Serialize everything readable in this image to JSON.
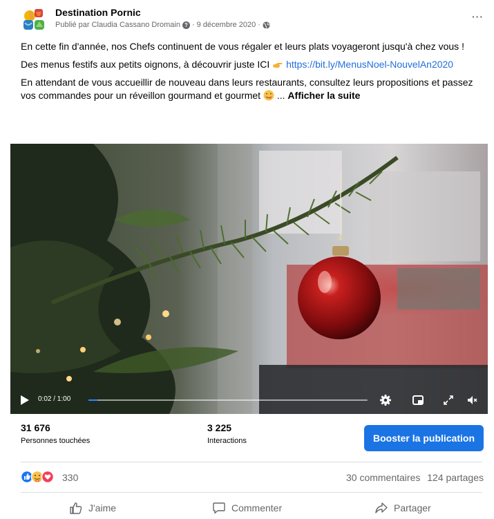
{
  "post": {
    "page_name": "Destination Pornic",
    "meta": {
      "published_by": "Publié par Claudia Cassano Dromain",
      "separator": "·",
      "date": "9 décembre 2020",
      "separator2": "·"
    },
    "more_label": "···",
    "text": {
      "p1": "En cette fin d'année, nos Chefs continuent de vous régaler et leurs plats voyageront jusqu'à chez vous !",
      "p2_before": "Des menus festifs aux petits oignons, à découvrir juste ICI",
      "p2_link": "https://bit.ly/MenusNoel-NouvelAn2020",
      "p3_before": "En attendant de vous accueillir de nouveau dans leurs restaurants, consultez leurs propositions et passez vos commandes pour un réveillon gourmand et gourmet",
      "p3_ellipsis": "...",
      "see_more": "Afficher la suite"
    }
  },
  "video": {
    "time": "0:02 / 1:00",
    "progress": 0.033
  },
  "stats": {
    "reach_value": "31 676",
    "reach_label": "Personnes touchées",
    "interactions_value": "3 225",
    "interactions_label": "Interactions",
    "boost_label": "Booster la publication"
  },
  "reactions": {
    "count": "330",
    "comments": "30 commentaires",
    "shares": "124 partages"
  },
  "actions": {
    "like": "J'aime",
    "comment": "Commenter",
    "share": "Partager"
  },
  "colors": {
    "accent": "#1b74e4",
    "link": "#216fdb",
    "muted": "#65676b"
  }
}
